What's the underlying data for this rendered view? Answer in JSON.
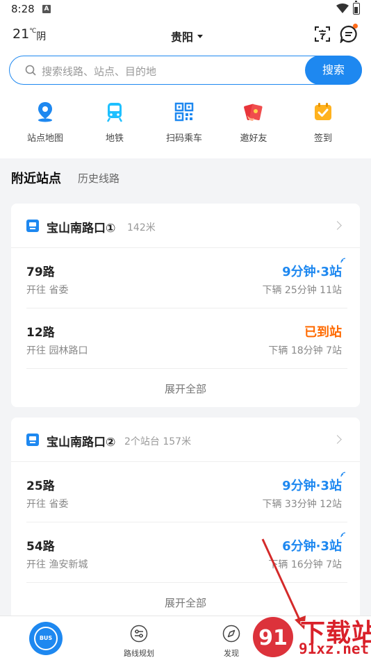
{
  "status_bar": {
    "time": "8:28",
    "notif_letter": "A"
  },
  "header": {
    "temperature": "21",
    "temp_unit": "℃",
    "condition": "阴",
    "city": "贵阳",
    "icons": [
      "translate-icon",
      "message-icon"
    ],
    "badge_color": "#ff6b1a"
  },
  "search": {
    "placeholder": "搜索线路、站点、目的地",
    "button": "搜索"
  },
  "quick_actions": [
    {
      "label": "站点地图",
      "icon": "station-map-pin-icon"
    },
    {
      "label": "地铁",
      "icon": "subway-icon"
    },
    {
      "label": "扫码乘车",
      "icon": "qr-code-icon"
    },
    {
      "label": "邀好友",
      "icon": "red-envelope-icon"
    },
    {
      "label": "签到",
      "icon": "check-in-calendar-icon"
    }
  ],
  "section_tabs": {
    "active": "附近站点",
    "inactive": "历史线路"
  },
  "stations": [
    {
      "name": "宝山南路口①",
      "distance": "142米",
      "routes": [
        {
          "name": "79路",
          "direction": "开往 省委",
          "eta": "9分钟·3站",
          "next": "下辆  25分钟 11站",
          "arrived": false
        },
        {
          "name": "12路",
          "direction": "开往 园林路口",
          "eta": "已到站",
          "next": "下辆  18分钟 7站",
          "arrived": true
        }
      ],
      "expand": "展开全部"
    },
    {
      "name": "宝山南路口②",
      "distance": "2个站台 157米",
      "routes": [
        {
          "name": "25路",
          "direction": "开往 省委",
          "eta": "9分钟·3站",
          "next": "下辆  33分钟 12站",
          "arrived": false
        },
        {
          "name": "54路",
          "direction": "开往 渔安新城",
          "eta": "6分钟·3站",
          "next": "下辆  16分钟 7站",
          "arrived": false
        }
      ],
      "expand": "展开全部"
    }
  ],
  "bottom_nav": {
    "home_badge": "BUS",
    "items": [
      {
        "label": "路线规划",
        "icon": "route-plan-icon"
      },
      {
        "label": "发现",
        "icon": "compass-icon"
      }
    ]
  },
  "watermark": {
    "line1": "下载站",
    "line2": "91xz.net",
    "logo_digits": "91"
  },
  "colors": {
    "accent": "#1e88f0",
    "arrived": "#ff6a00",
    "watermark": "#d9212a"
  }
}
